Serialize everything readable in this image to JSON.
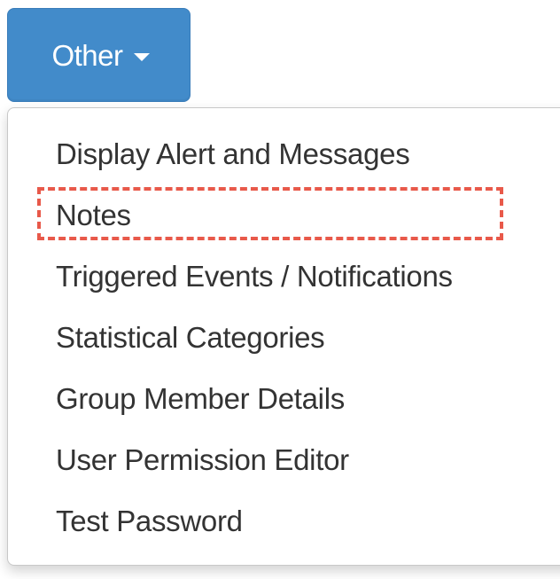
{
  "button": {
    "label": "Other",
    "color": "#428bca",
    "icon": "caret-down-icon"
  },
  "menu": {
    "items": [
      {
        "label": "Display Alert and Messages"
      },
      {
        "label": "Notes"
      },
      {
        "label": "Triggered Events / Notifications"
      },
      {
        "label": "Statistical Categories"
      },
      {
        "label": "Group Member Details"
      },
      {
        "label": "User Permission Editor"
      },
      {
        "label": "Test Password"
      }
    ],
    "highlighted_item": "Notes",
    "highlight_color": "#e8594a"
  }
}
